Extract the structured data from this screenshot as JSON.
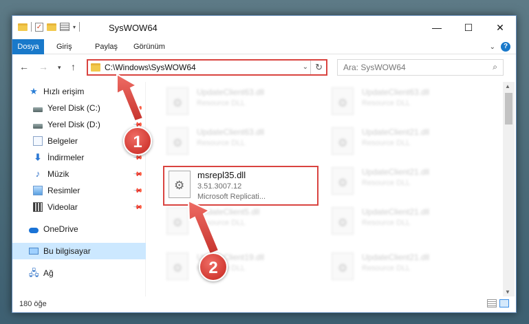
{
  "window": {
    "title": "SysWOW64",
    "controls": {
      "minimize": "—",
      "maximize": "☐",
      "close": "✕"
    }
  },
  "ribbon": {
    "tabs": [
      "Dosya",
      "Giriş",
      "Paylaş",
      "Görünüm"
    ]
  },
  "nav": {
    "address": "C:\\Windows\\SysWOW64",
    "search_placeholder": "Ara: SysWOW64"
  },
  "sidebar": {
    "items": [
      {
        "label": "Hızlı erişim",
        "icon": "star-icon"
      },
      {
        "label": "Yerel Disk (C:)",
        "icon": "drive-icon",
        "pinned": true
      },
      {
        "label": "Yerel Disk (D:)",
        "icon": "drive-icon",
        "pinned": true
      },
      {
        "label": "Belgeler",
        "icon": "documents-icon",
        "pinned": true
      },
      {
        "label": "İndirmeler",
        "icon": "download-icon",
        "pinned": true
      },
      {
        "label": "Müzik",
        "icon": "music-icon",
        "pinned": true
      },
      {
        "label": "Resimler",
        "icon": "pictures-icon",
        "pinned": true
      },
      {
        "label": "Videolar",
        "icon": "videos-icon",
        "pinned": true
      },
      {
        "label": "OneDrive",
        "icon": "cloud-icon"
      },
      {
        "label": "Bu bilgisayar",
        "icon": "computer-icon",
        "selected": true
      },
      {
        "label": "Ağ",
        "icon": "network-icon"
      }
    ]
  },
  "files": {
    "background_tiles": [
      {
        "name": "UpdateClient63.dll",
        "type": "Resource DLL"
      },
      {
        "name": "UpdateClient63.dll",
        "type": "Resource DLL"
      },
      {
        "name": "UpdateClient63.dll",
        "type": "Resource DLL"
      },
      {
        "name": "UpdateClient21.dll",
        "type": "Resource DLL"
      },
      {
        "name": "UpdateClient21.dll",
        "type": "Resource DLL"
      },
      {
        "name": "UpdateClient5.dll",
        "type": "Resource DLL"
      },
      {
        "name": "UpdateClient21.dll",
        "type": "Resource DLL"
      },
      {
        "name": "UpdateClient19.dll",
        "type": "Resource DLL"
      },
      {
        "name": "UpdateClient21.dll",
        "type": "Resource DLL"
      }
    ],
    "highlighted": {
      "name": "msrepl35.dll",
      "version": "3.51.3007.12",
      "description": "Microsoft Replicati..."
    }
  },
  "status": {
    "item_count": "180 öğe"
  },
  "annotations": {
    "step1": "1",
    "step2": "2",
    "color": "#d9433f"
  }
}
